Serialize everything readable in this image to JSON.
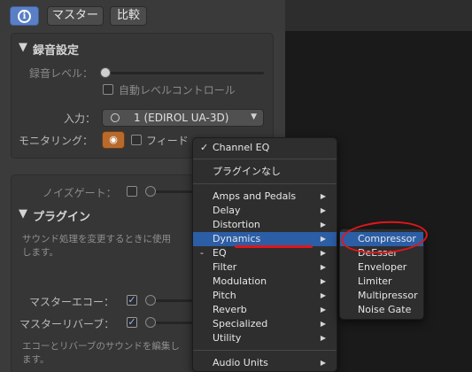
{
  "toolbar": {
    "info_label": "i",
    "master_label": "マスター",
    "compare_label": "比較"
  },
  "recording": {
    "section_title": "録音設定",
    "level_label": "録音レベル：",
    "auto_level_label": "自動レベルコントロール",
    "input_label": "入力：",
    "input_value": "1  (EDIROL UA-3D)",
    "monitoring_label": "モニタリング：",
    "feedback_label": "フィード"
  },
  "plugins": {
    "noise_gate_label": "ノイズゲート：",
    "section_title": "プラグイン",
    "description_line1": "サウンド処理を変更するときに使用",
    "description_line2": "します。",
    "master_echo_label": "マスターエコー：",
    "master_reverb_label": "マスターリバーブ：",
    "footer_line1": "エコーとリバーブのサウンドを編集し",
    "footer_line2": "ます。"
  },
  "menu": {
    "checked_item": "Channel EQ",
    "no_plugin": "プラグインなし",
    "items": [
      "Amps and Pedals",
      "Delay",
      "Distortion",
      "Dynamics",
      "EQ",
      "Filter",
      "Modulation",
      "Pitch",
      "Reverb",
      "Specialized",
      "Utility"
    ],
    "audio_units": "Audio Units",
    "highlighted": "Dynamics"
  },
  "submenu": {
    "items": [
      "Compressor",
      "DeEsser",
      "Enveloper",
      "Limiter",
      "Multipressor",
      "Noise Gate"
    ],
    "highlighted": "Compressor"
  },
  "colors": {
    "highlight": "#2c5ea6",
    "annotation": "#e0161b",
    "monitor_button": "#b86a2d",
    "info_button": "#5a7fc4"
  }
}
